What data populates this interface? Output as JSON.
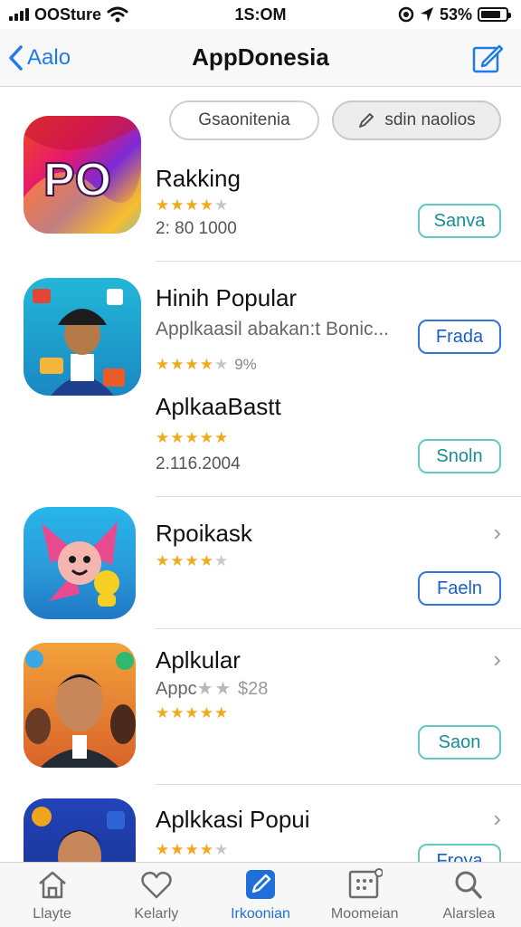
{
  "status": {
    "carrier": "OOSture",
    "time": "1S:OM",
    "battery": "53%"
  },
  "nav": {
    "back_label": "Aalo",
    "title": "AppDonesia"
  },
  "pills": {
    "left": "Gsaonitenia",
    "right": "sdin naolios"
  },
  "items": [
    {
      "icon": "po-logo-app-icon",
      "title": "Rakking",
      "stars": "★★★★",
      "stars_off": "★",
      "meta": "2: 80 1000",
      "button": "Sanva"
    },
    {
      "icon": "boy-with-cap-app-icon",
      "title": "Hinih Popular",
      "subtitle": "Applkaasil abakan:t Bonic...",
      "stars": "★★★★",
      "stars_off": "★",
      "stars_extra": "9%",
      "button": "Frada"
    },
    {
      "title": "AplkaaBastt",
      "stars": "★★★★★",
      "meta": "2.116.2004",
      "button": "Snoln"
    },
    {
      "icon": "cartoon-flower-app-icon",
      "title": "Rpoikask",
      "stars": "★★★★",
      "stars_off": "★",
      "button": "Faeln"
    },
    {
      "icon": "portrait-group-app-icon",
      "title": "Aplkular",
      "subtitle": "Appc",
      "subtitle_stars": "★★",
      "subtitle_extra": "$28",
      "stars": "★★★★★",
      "button": "Saon"
    },
    {
      "icon": "boy-portrait-app-icon",
      "title": "Aplkkasi Popui",
      "stars": "★★★★",
      "stars_off": "★",
      "button": "Froya"
    }
  ],
  "tabs": [
    {
      "label": "Llayte",
      "icon": "home-icon"
    },
    {
      "label": "Kelarly",
      "icon": "heart-icon"
    },
    {
      "label": "Irkoonian",
      "icon": "pen-icon",
      "active": true
    },
    {
      "label": "Moomeian",
      "icon": "grid-box-icon"
    },
    {
      "label": "Alarslea",
      "icon": "search-icon"
    }
  ],
  "colors": {
    "accent": "#1e7be8",
    "teal": "#63c7c2",
    "star": "#f2a81d"
  }
}
